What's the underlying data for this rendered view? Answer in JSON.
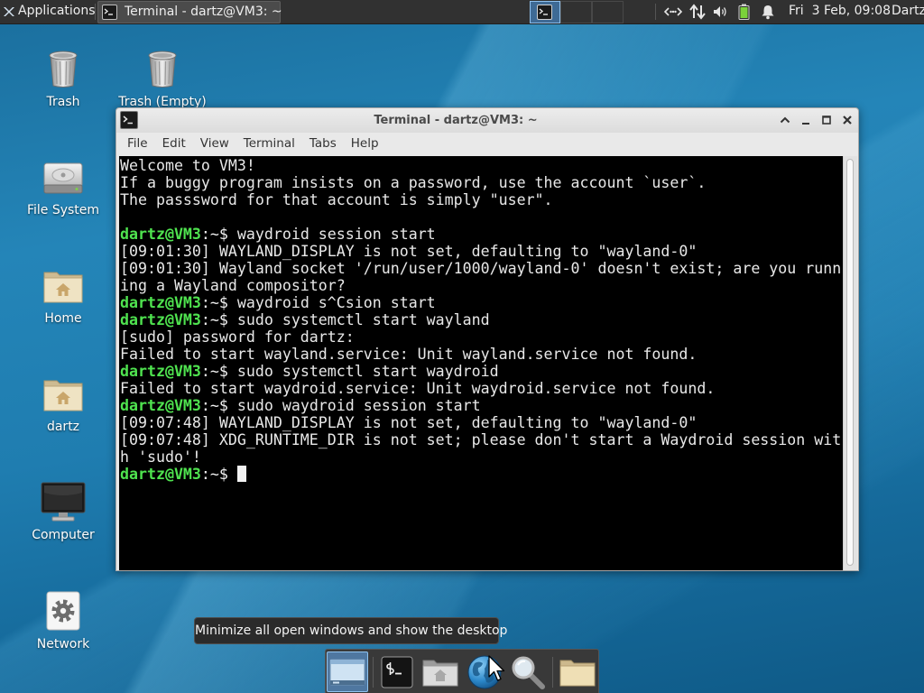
{
  "panel": {
    "apps_label": "Applications",
    "task_label": "Terminal - dartz@VM3: ~",
    "clock": "Fri  3 Feb, 09:08",
    "user": "Dartz",
    "tray_icons": [
      "network-icon",
      "network-activity-icon",
      "volume-icon",
      "battery-icon",
      "notification-bell-icon"
    ]
  },
  "desktop": {
    "icons": [
      {
        "label": "Trash",
        "icon": "trash-icon"
      },
      {
        "label": "Trash (Empty)",
        "icon": "trash-icon"
      },
      {
        "label": "File System",
        "icon": "hard-drive-icon"
      },
      {
        "label": "Home",
        "icon": "home-folder-icon"
      },
      {
        "label": "dartz",
        "icon": "home-folder-icon"
      },
      {
        "label": "Computer",
        "icon": "monitor-icon"
      },
      {
        "label": "Network",
        "icon": "network-gear-icon"
      }
    ]
  },
  "window": {
    "title": "Terminal - dartz@VM3: ~",
    "menu": [
      "File",
      "Edit",
      "View",
      "Terminal",
      "Tabs",
      "Help"
    ],
    "buttons": [
      "shade-icon",
      "minimize-icon",
      "maximize-icon",
      "close-icon"
    ]
  },
  "terminal": {
    "prompt_user": "dartz@VM3",
    "prompt_suffix": ":~$ ",
    "lines": [
      {
        "kind": "output",
        "text": "Welcome to VM3!"
      },
      {
        "kind": "output",
        "text": "If a buggy program insists on a password, use the account `user`."
      },
      {
        "kind": "output",
        "text": "The passsword for that account is simply \"user\"."
      },
      {
        "kind": "output",
        "text": ""
      },
      {
        "kind": "prompt",
        "cmd": "waydroid session start"
      },
      {
        "kind": "output",
        "text": "[09:01:30] WAYLAND_DISPLAY is not set, defaulting to \"wayland-0\""
      },
      {
        "kind": "output",
        "text": "[09:01:30] Wayland socket '/run/user/1000/wayland-0' doesn't exist; are you runn"
      },
      {
        "kind": "output",
        "text": "ing a Wayland compositor?"
      },
      {
        "kind": "prompt",
        "cmd": "waydroid s^Csion start"
      },
      {
        "kind": "prompt",
        "cmd": "sudo systemctl start wayland"
      },
      {
        "kind": "output",
        "text": "[sudo] password for dartz:"
      },
      {
        "kind": "output",
        "text": "Failed to start wayland.service: Unit wayland.service not found."
      },
      {
        "kind": "prompt",
        "cmd": "sudo systemctl start waydroid"
      },
      {
        "kind": "output",
        "text": "Failed to start waydroid.service: Unit waydroid.service not found."
      },
      {
        "kind": "prompt",
        "cmd": "sudo waydroid session start"
      },
      {
        "kind": "output",
        "text": "[09:07:48] WAYLAND_DISPLAY is not set, defaulting to \"wayland-0\""
      },
      {
        "kind": "output",
        "text": "[09:07:48] XDG_RUNTIME_DIR is not set; please don't start a Waydroid session wit"
      },
      {
        "kind": "output",
        "text": "h 'sudo'!"
      },
      {
        "kind": "prompt",
        "cmd": "",
        "cursor": true
      }
    ]
  },
  "tooltip": "Minimize all open windows and show the desktop",
  "dock": {
    "items": [
      "show-desktop-icon",
      "terminal-icon",
      "home-folder-icon",
      "web-browser-icon",
      "app-finder-icon",
      "file-manager-icon"
    ]
  },
  "colors": {
    "prompt_green": "#4fe34f",
    "terminal_fg": "#e8e8e8",
    "terminal_bg": "#000000",
    "panel_bg": "#313131",
    "active_highlight": "#8fc3ef"
  }
}
